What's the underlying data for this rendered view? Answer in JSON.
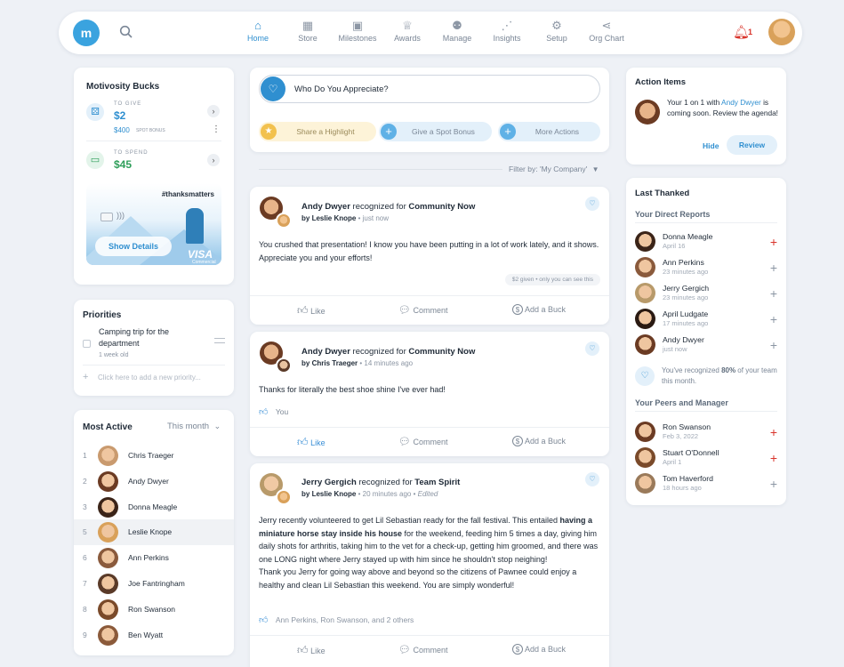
{
  "nav": {
    "items": [
      {
        "label": "Home",
        "icon": "home-icon",
        "glyph": "⌂"
      },
      {
        "label": "Store",
        "icon": "store-icon",
        "glyph": "▦"
      },
      {
        "label": "Milestones",
        "icon": "calendar-icon",
        "glyph": "▣"
      },
      {
        "label": "Awards",
        "icon": "trophy-icon",
        "glyph": "♕"
      },
      {
        "label": "Manage",
        "icon": "people-icon",
        "glyph": "⚉"
      },
      {
        "label": "Insights",
        "icon": "insights-icon",
        "glyph": "⋰"
      },
      {
        "label": "Setup",
        "icon": "gear-icon",
        "glyph": "⚙"
      },
      {
        "label": "Org Chart",
        "icon": "org-chart-icon",
        "glyph": "⋖"
      }
    ],
    "notif_count": "1",
    "logo_text": "m"
  },
  "bucks": {
    "title": "Motivosity Bucks",
    "to_give_label": "TO GIVE",
    "to_give_value": "$2",
    "spot_amount": "$400",
    "spot_label": "SPOT BONUS",
    "to_spend_label": "TO SPEND",
    "to_spend_value": "$45",
    "card_tag": "#thanksmatters",
    "show_details": "Show Details",
    "visa": "VISA",
    "visa_sub": "Commercial"
  },
  "priorities": {
    "title": "Priorities",
    "item": "Camping trip for the department",
    "item_age": "1 week old",
    "add_placeholder": "Click here to add a new priority..."
  },
  "most_active": {
    "title": "Most Active",
    "range": "This month",
    "people": [
      {
        "rank": "1",
        "name": "Chris Traeger"
      },
      {
        "rank": "2",
        "name": "Andy Dwyer"
      },
      {
        "rank": "3",
        "name": "Donna Meagle"
      },
      {
        "rank": "5",
        "name": "Leslie Knope"
      },
      {
        "rank": "6",
        "name": "Ann Perkins"
      },
      {
        "rank": "7",
        "name": "Joe Fantringham"
      },
      {
        "rank": "8",
        "name": "Ron Swanson"
      },
      {
        "rank": "9",
        "name": "Ben Wyatt"
      }
    ]
  },
  "appreciate": {
    "placeholder": "Who Do You Appreciate?",
    "share": "Share a Highlight",
    "spot": "Give a Spot Bonus",
    "more": "More Actions"
  },
  "filter": "Filter by: 'My Company'",
  "posts": [
    {
      "recipient": "Andy Dwyer",
      "recognized_for": "recognized for",
      "value": "Community Now",
      "by": "by",
      "giver": "Leslie Knope",
      "time": "just now",
      "edited": "",
      "body": "You crushed that presentation! I know you have been putting in a lot of work lately, and it shows. Appreciate you and your efforts!",
      "given": "$2 given",
      "visibility": "only you can see this",
      "likes": "",
      "like": "Like",
      "comment": "Comment",
      "add_buck": "Add a Buck"
    },
    {
      "recipient": "Andy Dwyer",
      "recognized_for": "recognized for",
      "value": "Community Now",
      "by": "by",
      "giver": "Chris Traeger",
      "time": "14 minutes ago",
      "edited": "",
      "body": "Thanks for literally the best shoe shine I've ever had!",
      "likes": "You",
      "like": "Like",
      "comment": "Comment",
      "add_buck": "Add a Buck"
    },
    {
      "recipient": "Jerry Gergich",
      "recognized_for": "recognized for",
      "value": "Team Spirit",
      "by": "by",
      "giver": "Leslie Knope",
      "time": "20 minutes ago",
      "edited": "Edited",
      "body_1": "Jerry recently volunteered to get Lil Sebastian ready for the fall festival. This entailed ",
      "body_bold": "having a miniature horse stay inside his house",
      "body_2": " for the weekend, feeding him 5 times a day, giving him daily shots for arthritis, taking him to the vet for a check-up, getting him groomed, and there was one LONG night where Jerry stayed up with him since he shouldn't stop neighing!",
      "body_3": "Thank you Jerry for going way above and beyond so the citizens of Pawnee could enjoy a healthy and clean Lil Sebastian this weekend. You are simply wonderful!",
      "likes": "Ann Perkins, Ron Swanson, and 2 others",
      "like": "Like",
      "comment": "Comment",
      "add_buck": "Add a Buck"
    }
  ],
  "action_items": {
    "title": "Action Items",
    "text_1": "Your 1 on 1 with ",
    "text_name": "Andy Dwyer",
    "text_2": " is coming soon. Review the agenda!",
    "hide": "Hide",
    "review": "Review"
  },
  "last_thanked": {
    "title": "Last Thanked",
    "direct_title": "Your Direct Reports",
    "direct": [
      {
        "name": "Donna Meagle",
        "time": "April 16",
        "plus_color": "#d9342b"
      },
      {
        "name": "Ann Perkins",
        "time": "23 minutes ago",
        "plus_color": "#8b95a3"
      },
      {
        "name": "Jerry Gergich",
        "time": "23 minutes ago",
        "plus_color": "#8b95a3"
      },
      {
        "name": "April Ludgate",
        "time": "17 minutes ago",
        "plus_color": "#8b95a3"
      },
      {
        "name": "Andy Dwyer",
        "time": "just now",
        "plus_color": "#8b95a3"
      }
    ],
    "stat_1": "You've recognized ",
    "stat_pct": "80%",
    "stat_2": " of your team this month.",
    "peers_title": "Your Peers and Manager",
    "peers": [
      {
        "name": "Ron Swanson",
        "time": "Feb 3, 2022",
        "plus_color": "#d9342b"
      },
      {
        "name": "Stuart O'Donnell",
        "time": "April 1",
        "plus_color": "#d9342b"
      },
      {
        "name": "Tom Haverford",
        "time": "18 hours ago",
        "plus_color": "#8b95a3"
      }
    ]
  },
  "colors": {
    "accent": "#2f8fd0",
    "brand": "#3aa3df",
    "alert": "#d9342b",
    "money": "#2f9e5a"
  }
}
